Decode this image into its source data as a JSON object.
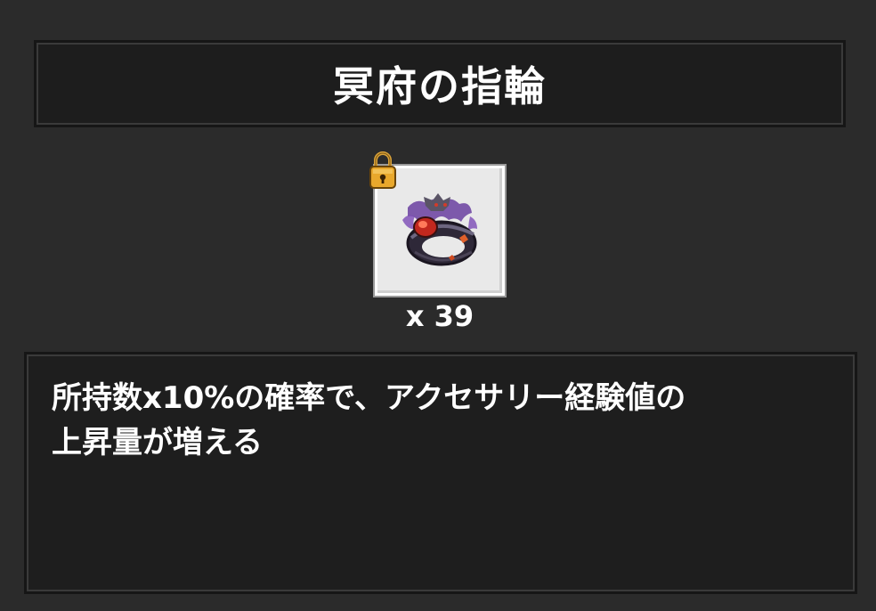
{
  "item": {
    "name": "冥府の指輪",
    "count": "x 39",
    "description": "所持数x10%の確率で、アクセサリー経験値の\n上昇量が増える",
    "icon": "dark-ring-icon",
    "locked_icon": "padlock-icon"
  },
  "colors": {
    "background": "#2b2b2b",
    "panel": "#1d1d1d",
    "slot": "#e9e9e9",
    "text": "#ffffff"
  }
}
